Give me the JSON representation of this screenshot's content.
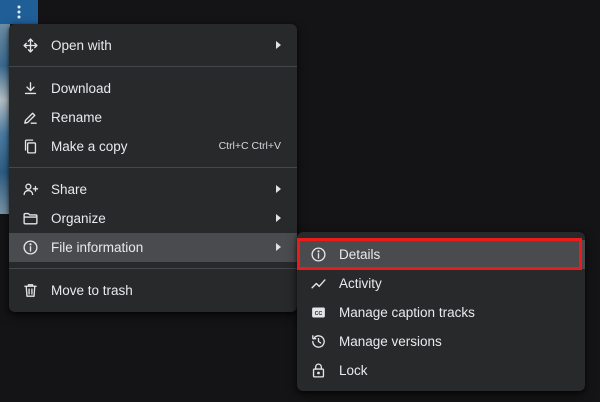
{
  "toolbar": {
    "more_actions_icon": "more-vert-icon",
    "accent_color": "#1f5e97"
  },
  "main_menu": {
    "items": [
      {
        "label": "Open with",
        "icon": "open-with-icon",
        "submenu": true
      },
      {
        "label": "Download",
        "icon": "download-icon"
      },
      {
        "label": "Rename",
        "icon": "rename-icon"
      },
      {
        "label": "Make a copy",
        "icon": "copy-icon",
        "shortcut": "Ctrl+C Ctrl+V"
      },
      {
        "label": "Share",
        "icon": "share-icon",
        "submenu": true
      },
      {
        "label": "Organize",
        "icon": "folder-icon",
        "submenu": true
      },
      {
        "label": "File information",
        "icon": "info-icon",
        "submenu": true,
        "active": true
      },
      {
        "label": "Move to trash",
        "icon": "trash-icon"
      }
    ]
  },
  "sub_menu": {
    "items": [
      {
        "label": "Details",
        "icon": "info-icon",
        "active": true,
        "highlighted": true
      },
      {
        "label": "Activity",
        "icon": "activity-icon"
      },
      {
        "label": "Manage caption tracks",
        "icon": "closed-caption-icon"
      },
      {
        "label": "Manage versions",
        "icon": "history-icon"
      },
      {
        "label": "Lock",
        "icon": "lock-icon"
      }
    ]
  },
  "colors": {
    "menu_bg": "#28292b",
    "active_bg": "#4a4b4e",
    "highlight": "#ea1b1b",
    "text": "#e8eaed"
  }
}
